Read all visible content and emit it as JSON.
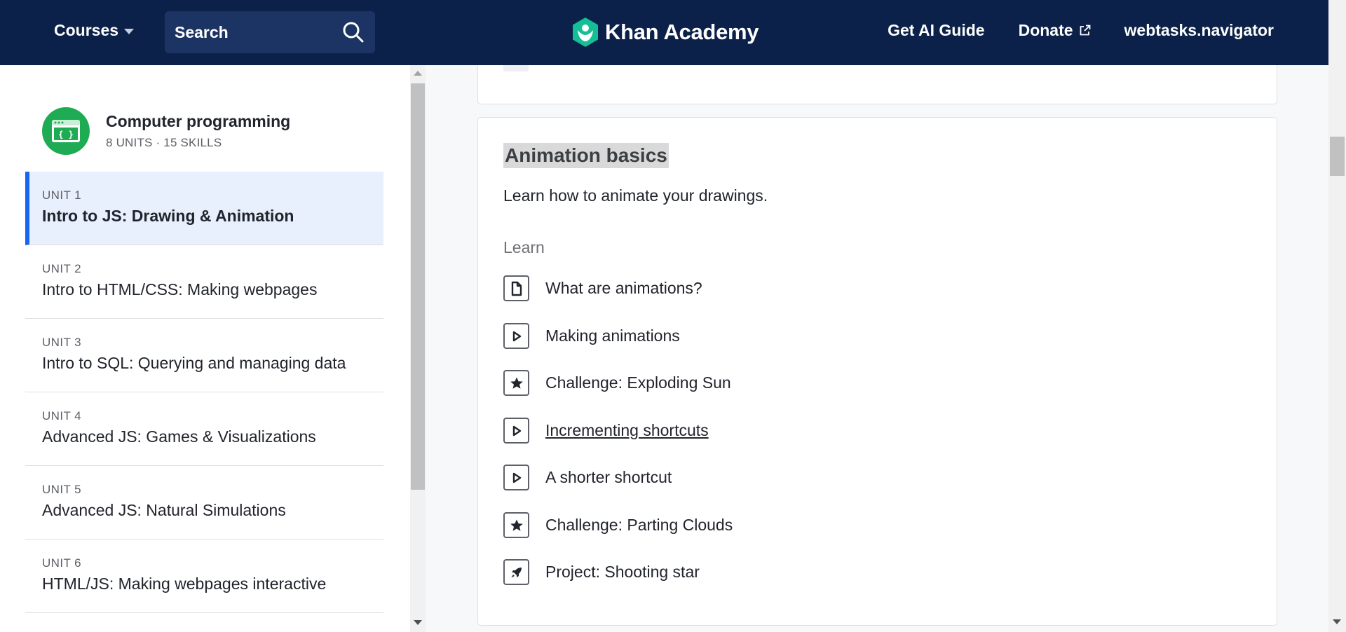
{
  "header": {
    "courses_label": "Courses",
    "search_label": "Search",
    "logo_text": "Khan Academy",
    "ai_guide_label": "Get AI Guide",
    "donate_label": "Donate",
    "user_label": "webtasks.navigator"
  },
  "sidebar": {
    "course_title": "Computer programming",
    "course_meta": "8 UNITS · 15 SKILLS",
    "units": [
      {
        "num": "UNIT 1",
        "title": "Intro to JS: Drawing & Animation",
        "active": true
      },
      {
        "num": "UNIT 2",
        "title": "Intro to HTML/CSS: Making webpages"
      },
      {
        "num": "UNIT 3",
        "title": "Intro to SQL: Querying and managing data"
      },
      {
        "num": "UNIT 4",
        "title": "Advanced JS: Games & Visualizations"
      },
      {
        "num": "UNIT 5",
        "title": "Advanced JS: Natural Simulations"
      },
      {
        "num": "UNIT 6",
        "title": "HTML/JS: Making webpages interactive"
      }
    ]
  },
  "lesson": {
    "title": "Animation basics",
    "description": "Learn how to animate your drawings.",
    "section_label": "Learn",
    "items": [
      {
        "icon": "article-icon",
        "label": "What are animations?"
      },
      {
        "icon": "play-icon",
        "label": "Making animations"
      },
      {
        "icon": "star-icon",
        "label": "Challenge: Exploding Sun"
      },
      {
        "icon": "play-icon",
        "label": "Incrementing shortcuts"
      },
      {
        "icon": "play-icon",
        "label": "A shorter shortcut"
      },
      {
        "icon": "star-icon",
        "label": "Challenge: Parting Clouds"
      },
      {
        "icon": "rocket-icon",
        "label": "Project: Shooting star"
      }
    ]
  },
  "colors": {
    "header_bg": "#0b2149",
    "accent_blue": "#1865f2",
    "brand_green": "#1fab54",
    "active_bg": "#e8f0fd"
  }
}
